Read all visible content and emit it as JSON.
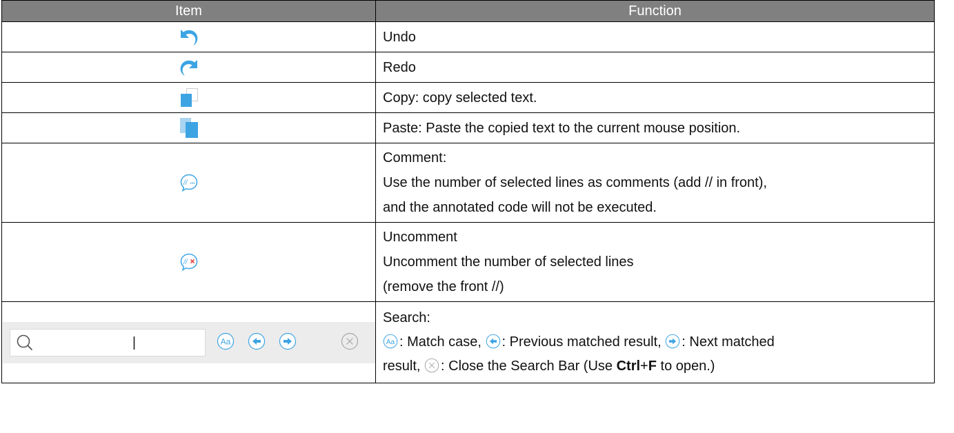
{
  "header": {
    "item": "Item",
    "function": "Function"
  },
  "rows": {
    "undo": {
      "icon": "undo-arrow-icon",
      "text": "Undo"
    },
    "redo": {
      "icon": "redo-arrow-icon",
      "text": "Redo"
    },
    "copy": {
      "icon": "copy-icon",
      "text": "Copy: copy selected text."
    },
    "paste": {
      "icon": "paste-icon",
      "text": "Paste: Paste the copied text to the current mouse position."
    },
    "comment": {
      "icon": "comment-icon",
      "title": "Comment:",
      "line1": "Use the number of selected lines as comments (add // in front),",
      "line2": "and the annotated code will not be executed."
    },
    "uncomment": {
      "icon": "uncomment-icon",
      "title": "Uncomment",
      "line1": "Uncomment the number of selected lines",
      "line2": "(remove the front //)"
    },
    "search": {
      "bar": {
        "input_value": "|",
        "icons": [
          "magnifier-icon",
          "match-case-icon",
          "previous-result-icon",
          "next-result-icon",
          "close-search-icon"
        ]
      },
      "title": "Search:",
      "match_case": ": Match case, ",
      "previous": ": Previous matched result, ",
      "next": ": Next matched",
      "next_cont": "result, ",
      "close": ": Close the Search Bar (Use ",
      "ctrl": "Ctrl",
      "plus": "+",
      "f": "F",
      "to_open": " to open.)"
    }
  },
  "colors": {
    "header_bg": "#808080",
    "icon_blue": "#3da4e3",
    "search_bg": "#ececec"
  }
}
